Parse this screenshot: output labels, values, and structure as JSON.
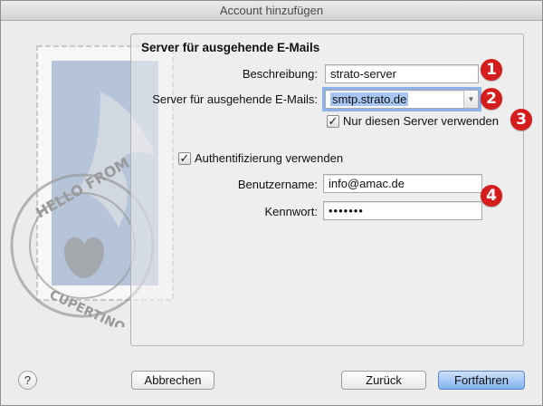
{
  "window": {
    "title": "Account hinzufügen"
  },
  "panel": {
    "title": "Server für ausgehende E-Mails"
  },
  "form": {
    "description": {
      "label": "Beschreibung:",
      "value": "strato-server"
    },
    "outgoing_server": {
      "label": "Server für ausgehende E-Mails:",
      "value": "smtp.strato.de"
    },
    "only_this_server": {
      "label": "Nur diesen Server verwenden",
      "checked": true
    },
    "use_auth": {
      "label": "Authentifizierung verwenden",
      "checked": true
    },
    "username": {
      "label": "Benutzername:",
      "value": "info@amac.de"
    },
    "password": {
      "label": "Kennwort:",
      "value": "•••••••"
    }
  },
  "stamp": {
    "text_top": "HELLO FROM",
    "text_bottom": "CUPERTINO, CA"
  },
  "markers": [
    "1",
    "2",
    "3",
    "4"
  ],
  "buttons": {
    "help": "?",
    "cancel": "Abbrechen",
    "back": "Zurück",
    "continue": "Fortfahren"
  },
  "colors": {
    "accent": "#7fb2ee",
    "marker": "#d51d1d",
    "selection": "#a7c6f2"
  }
}
